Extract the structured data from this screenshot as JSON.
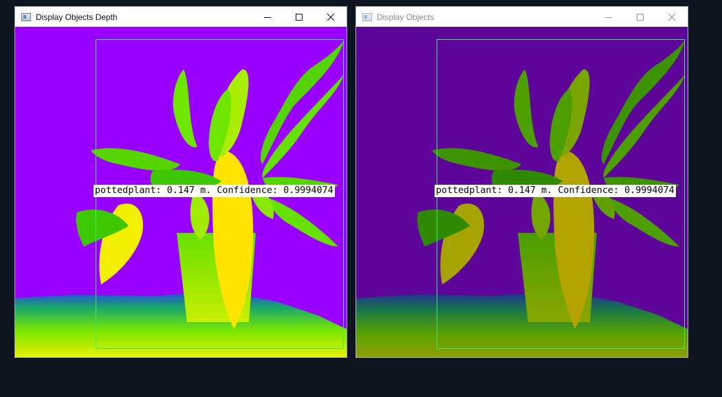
{
  "windows": [
    {
      "title": "Display Objects Depth",
      "state": "active",
      "icon": "app-window-icon",
      "controls": [
        "minimize-icon",
        "maximize-icon",
        "close-icon"
      ]
    },
    {
      "title": "Display Objects",
      "state": "inactive",
      "icon": "app-window-icon",
      "controls": [
        "minimize-icon",
        "maximize-icon",
        "close-icon"
      ]
    }
  ],
  "detection": {
    "label": "pottedplant: 0.147 m. Confidence: 0.9994074",
    "class": "pottedplant",
    "distance_m": 0.147,
    "confidence": 0.9994074,
    "box_color": "#3ee66a"
  },
  "colors": {
    "desktop": "#0e1420",
    "depth_background": "#9900ff",
    "depth_background_dim": "#5d0699",
    "plant_green": "#5fe600",
    "plant_yellow": "#ffee00",
    "floor_blue": "#1f3bd8"
  }
}
